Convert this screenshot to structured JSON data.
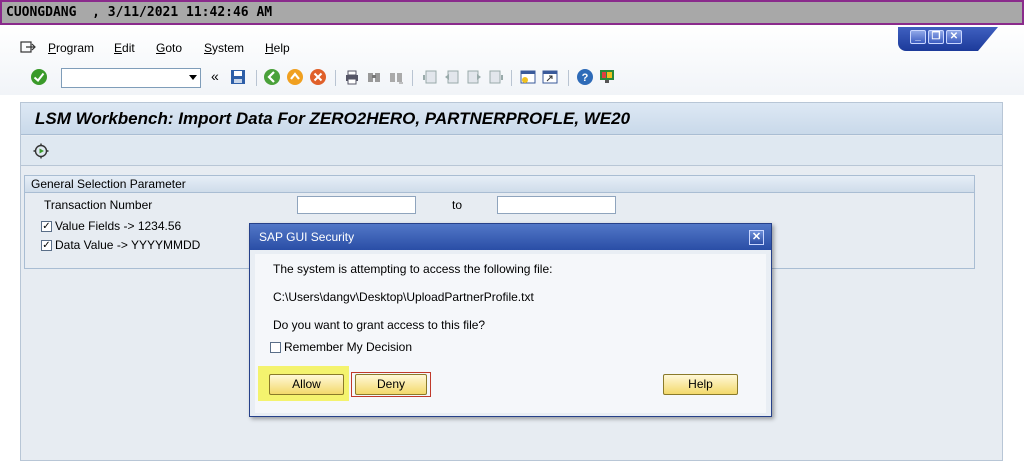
{
  "titlebar": {
    "text": "CUONGDANG  , 3/11/2021 11:42:46 AM"
  },
  "menu": {
    "items": [
      "Program",
      "Edit",
      "Goto",
      "System",
      "Help"
    ]
  },
  "window_controls": {
    "minimize": "_",
    "restore": "❐",
    "close": "✕"
  },
  "toolbar": {
    "command_field_value": "",
    "back_label": "«"
  },
  "screen": {
    "title": "LSM Workbench: Import Data For ZERO2HERO, PARTNERPROFLE, WE20",
    "group": {
      "title": "General Selection Parameter",
      "transaction_label": "Transaction Number",
      "to_label": "to",
      "from_value": "",
      "to_value": "",
      "check1_label": "Value Fields -> 1234.56",
      "check1_checked": true,
      "check2_label": "Data Value -> YYYYMMDD",
      "check2_checked": true
    }
  },
  "dialog": {
    "title": "SAP GUI Security",
    "line1": "The system is attempting to access the following file:",
    "path": "C:\\Users\\dangv\\Desktop\\UploadPartnerProfile.txt",
    "question": "Do you want to grant access to this file?",
    "remember_label": "Remember My Decision",
    "remember_checked": false,
    "allow_label": "Allow",
    "deny_label": "Deny",
    "help_label": "Help",
    "close": "✕"
  },
  "colors": {
    "highlight": "#f4f36e",
    "title_border": "#8a2b8c",
    "dialog_title": "#2a4ea6"
  }
}
